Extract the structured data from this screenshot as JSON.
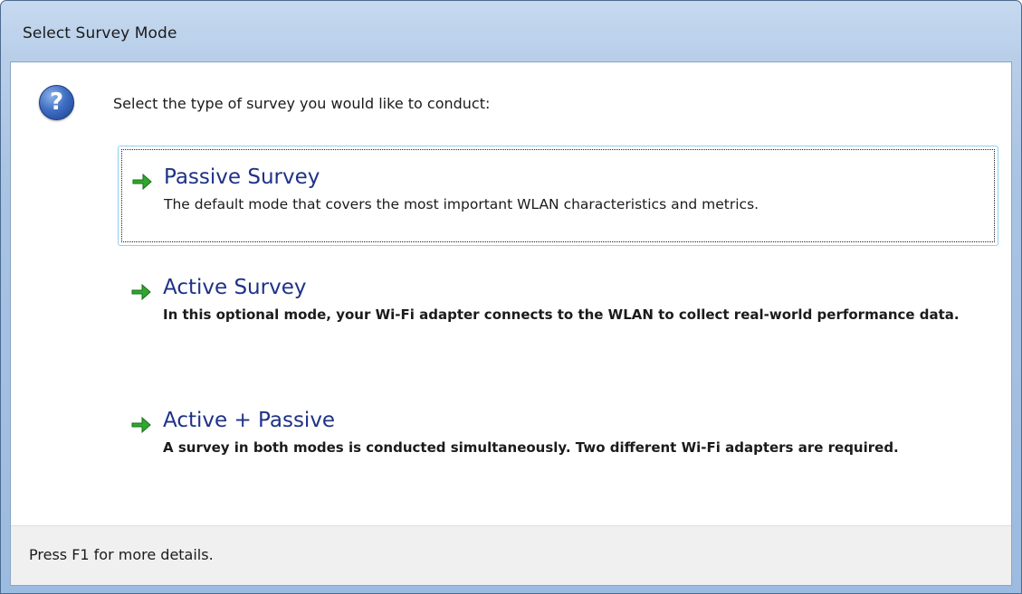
{
  "window": {
    "title": "Select Survey Mode"
  },
  "header": {
    "icon": "question-icon",
    "icon_glyph": "?",
    "instruction": "Select the type of survey you would like to conduct:"
  },
  "options": [
    {
      "icon": "green-arrow-icon",
      "title": "Passive Survey",
      "description": "The default mode that covers the most important WLAN characteristics and metrics.",
      "focused": true
    },
    {
      "icon": "green-arrow-icon",
      "title": "Active Survey",
      "description": "In this optional mode, your Wi-Fi adapter connects to the WLAN to collect real-world performance data.",
      "focused": false
    },
    {
      "icon": "green-arrow-icon",
      "title": "Active + Passive",
      "description": "A survey in both modes is conducted simultaneously. Two different Wi-Fi adapters are required.",
      "focused": false
    }
  ],
  "footer": {
    "text": "Press F1 for more details."
  },
  "colors": {
    "accent_title": "#1e3287",
    "arrow_green": "#2fa82f",
    "focus_border": "#8fd0ee"
  }
}
